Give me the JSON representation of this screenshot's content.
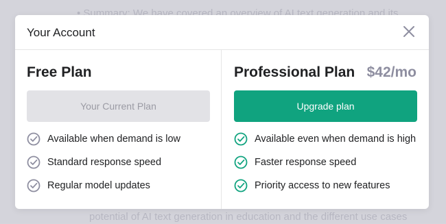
{
  "background": {
    "lines": [
      "• Summary: We have covered an overview of AI text generation and its",
      "potential of AI text generation in education and the different use cases"
    ]
  },
  "modal": {
    "title": "Your Account",
    "close_icon": "close-icon"
  },
  "free_plan": {
    "name": "Free Plan",
    "button_label": "Your Current Plan",
    "features": [
      "Available when demand is low",
      "Standard response speed",
      "Regular model updates"
    ],
    "check_color": "#8e8ea0"
  },
  "pro_plan": {
    "name": "Professional Plan",
    "price": "$42/mo",
    "button_label": "Upgrade plan",
    "features": [
      "Available even when demand is high",
      "Faster response speed",
      "Priority access to new features"
    ],
    "check_color": "#10a37f",
    "accent": "#10a37f"
  }
}
